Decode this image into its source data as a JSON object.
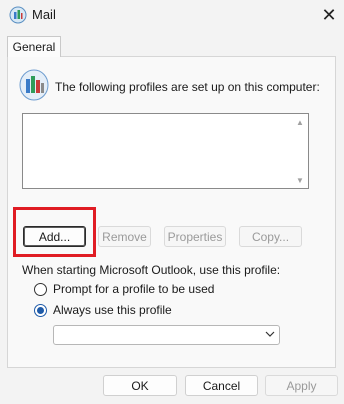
{
  "window": {
    "title": "Mail",
    "icon": "mail-profiles-icon",
    "close_glyph": "✕"
  },
  "tabs": [
    {
      "label": "General"
    }
  ],
  "profiles_section": {
    "description": "The following profiles are set up on this computer:",
    "profiles": [],
    "scroll_up_glyph": "▲",
    "scroll_down_glyph": "▼"
  },
  "profile_buttons": {
    "add": "Add...",
    "remove": "Remove",
    "properties": "Properties",
    "copy": "Copy..."
  },
  "startup": {
    "label": "When starting Microsoft Outlook, use this profile:",
    "options": [
      {
        "label": "Prompt for a profile to be used",
        "selected": false
      },
      {
        "label": "Always use this profile",
        "selected": true
      }
    ],
    "selected_profile": ""
  },
  "footer_buttons": {
    "ok": "OK",
    "cancel": "Cancel",
    "apply": "Apply"
  },
  "colors": {
    "highlight": "#e01c24",
    "radio_selected": "#1e5aa8"
  }
}
